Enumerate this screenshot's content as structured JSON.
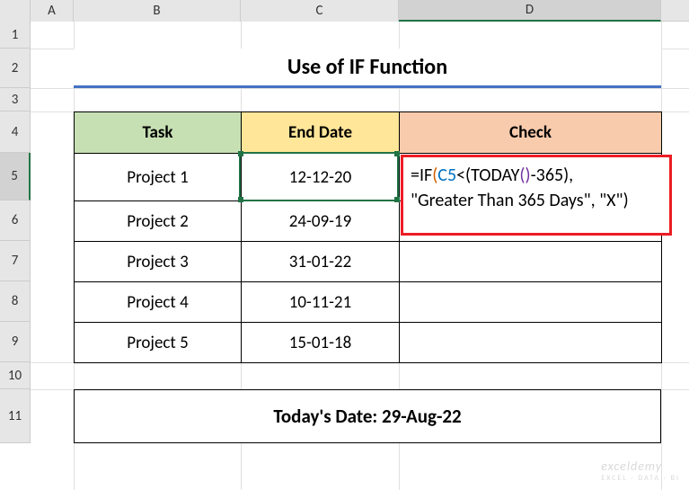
{
  "columns": {
    "A": "A",
    "B": "B",
    "C": "C",
    "D": "D"
  },
  "rows": [
    "1",
    "2",
    "3",
    "4",
    "5",
    "6",
    "7",
    "8",
    "9",
    "10",
    "11"
  ],
  "title": "Use of IF Function",
  "headers": {
    "task": "Task",
    "end_date": "End Date",
    "check": "Check"
  },
  "table": [
    {
      "task": "Project 1",
      "end_date": "12-12-20"
    },
    {
      "task": "Project 2",
      "end_date": "24-09-19"
    },
    {
      "task": "Project 3",
      "end_date": "31-01-22"
    },
    {
      "task": "Project 4",
      "end_date": "10-11-21"
    },
    {
      "task": "Project 5",
      "end_date": "15-01-18"
    }
  ],
  "formula": {
    "line1_pre": "=IF",
    "line1_paren_open": "(",
    "line1_ref": "C5",
    "line1_mid": "<(TODAY",
    "line1_inner": "(",
    "line1_inner_close": ")",
    "line1_after": "-365),",
    "line2": "\"Greater Than 365 Days\", \"X\")"
  },
  "today_label": "Today's Date: 29-Aug-22",
  "watermark": "exceldemy",
  "watermark_sub": "EXCEL · DATA · BI"
}
